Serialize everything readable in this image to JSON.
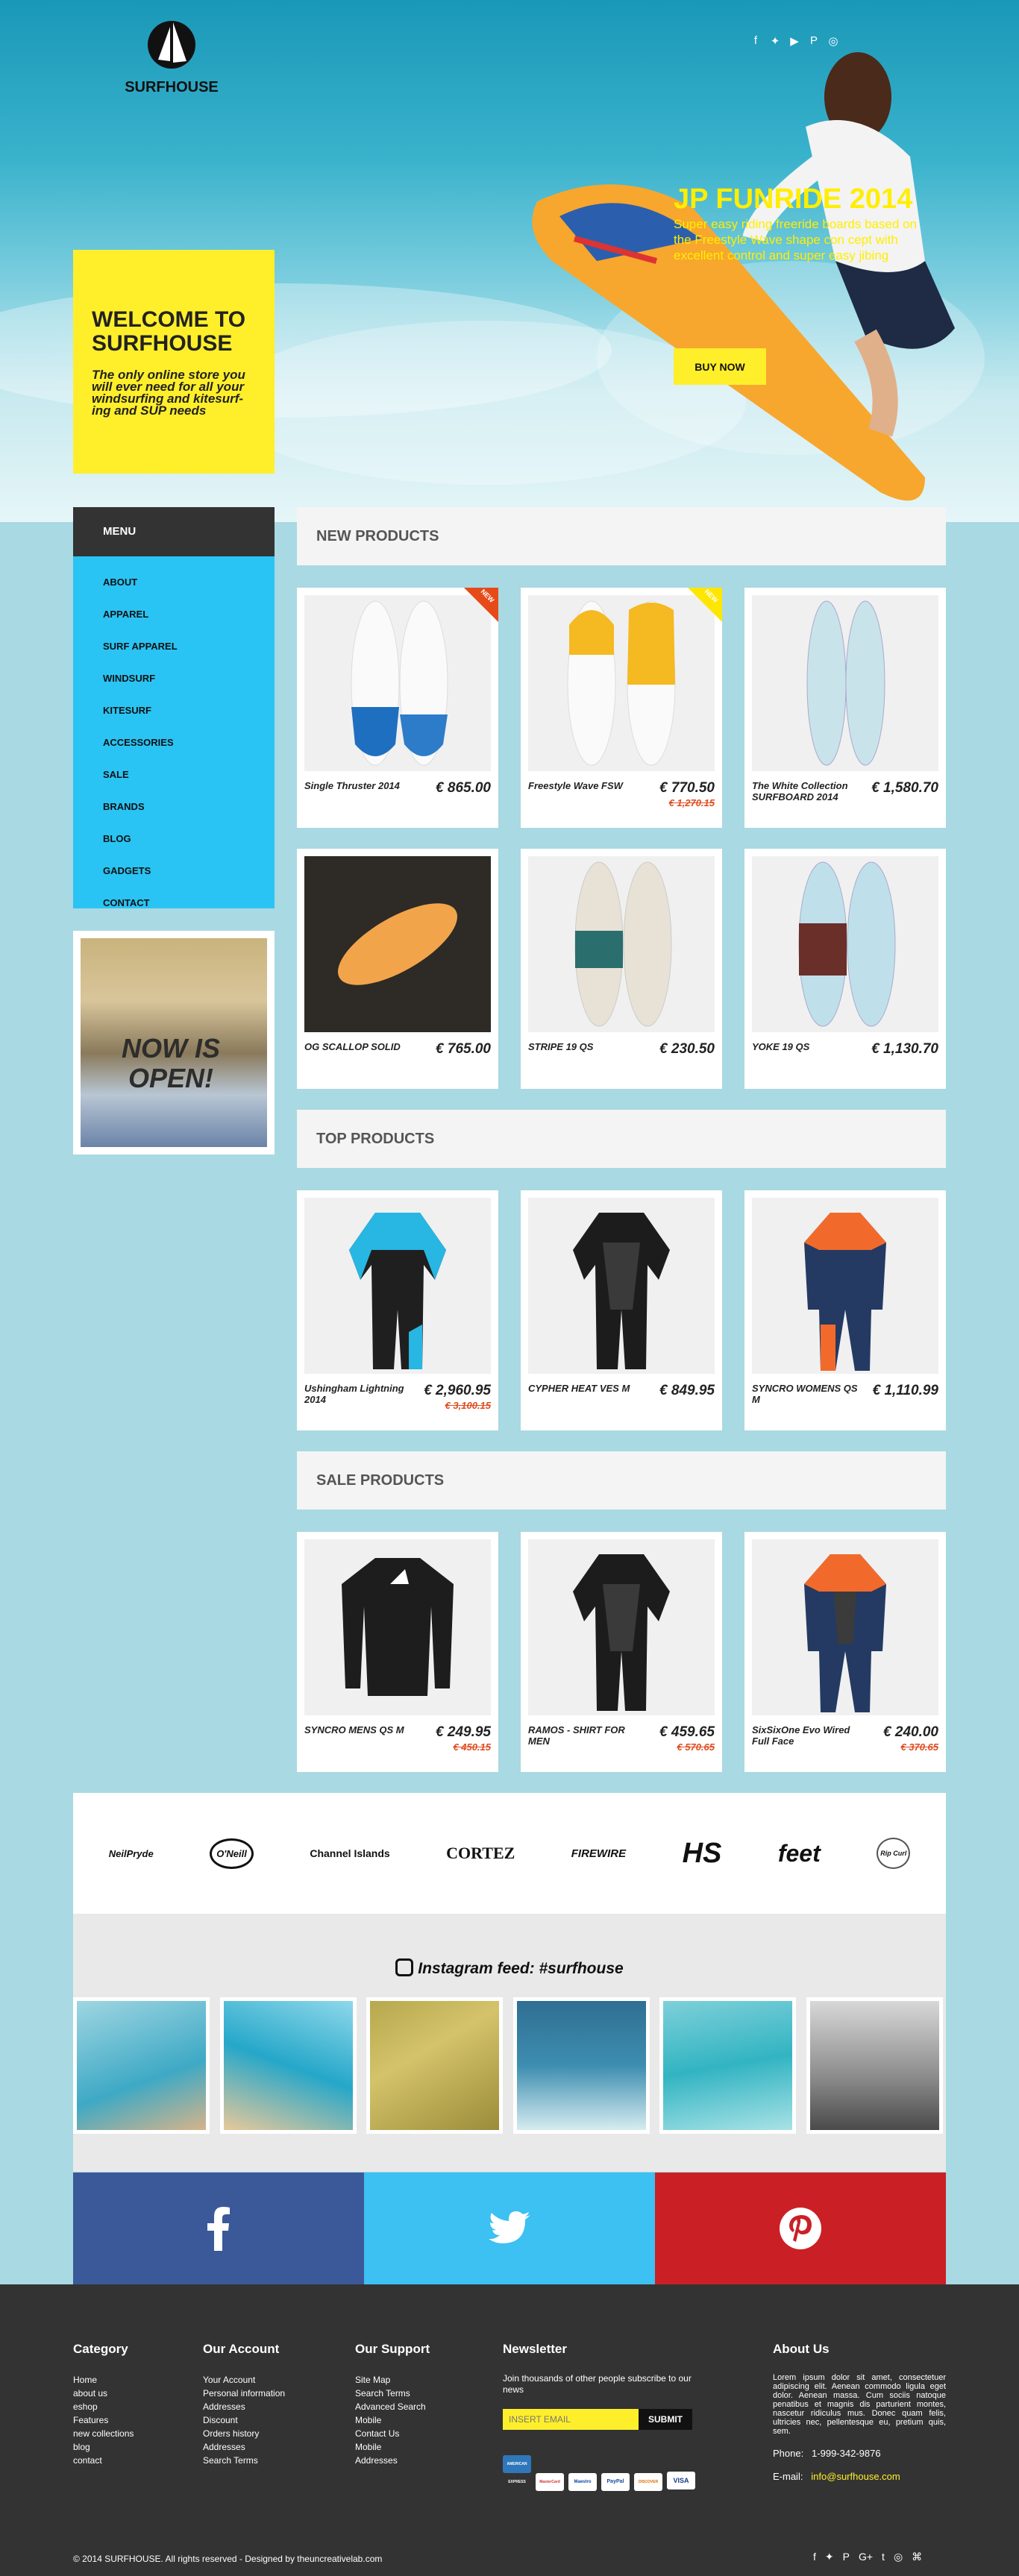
{
  "header": {
    "logo_text": "SURFHOUSE",
    "social_icons": [
      "facebook-icon",
      "twitter-icon",
      "youtube-icon",
      "pinterest-icon",
      "instagram-icon"
    ]
  },
  "welcome": {
    "title": "WELCOME TO SURFHOUSE",
    "subtitle": "The only online store you will ever need for all your windsurfing and kitesurf-ing and SUP needs"
  },
  "promo": {
    "title": "JP FUNRIDE 2014",
    "text": "Super easy riding freeride boards based on the Freestyle Wave shape con cept with excellent control and super easy jibing",
    "button": "BUY NOW"
  },
  "menu": {
    "title": "MENU",
    "items": [
      "ABOUT",
      "APPAREL",
      "SURF APPAREL",
      "WINDSURF",
      "KITESURF",
      "ACCESSORIES",
      "SALE",
      "BRANDS",
      "BLOG",
      "GADGETS",
      "CONTACT"
    ]
  },
  "shop_banner": "NOW IS OPEN!",
  "sections": {
    "new": "NEW PRODUCTS",
    "top": "TOP PRODUCTS",
    "sale": "SALE PRODUCTS"
  },
  "new_products": [
    {
      "name": "Single Thruster 2014",
      "price": "€ 865.00",
      "old": "",
      "tag": "NEW"
    },
    {
      "name": "Freestyle Wave FSW",
      "price": "€ 770.50",
      "old": "€ 1,270.15",
      "tag": "NEW"
    },
    {
      "name": "The White Collection SURFBOARD 2014",
      "price": "€ 1,580.70",
      "old": "",
      "tag": ""
    },
    {
      "name": "OG SCALLOP SOLID",
      "price": "€ 765.00",
      "old": "",
      "tag": ""
    },
    {
      "name": "STRIPE 19 QS",
      "price": "€ 230.50",
      "old": "",
      "tag": ""
    },
    {
      "name": "YOKE 19 QS",
      "price": "€ 1,130.70",
      "old": "",
      "tag": ""
    }
  ],
  "top_products": [
    {
      "name": "Ushingham Lightning 2014",
      "price": "€ 2,960.95",
      "old": "€ 3,100.15"
    },
    {
      "name": "CYPHER HEAT VES M",
      "price": "€ 849.95",
      "old": ""
    },
    {
      "name": "SYNCRO WOMENS QS M",
      "price": "€ 1,110.99",
      "old": ""
    }
  ],
  "sale_products": [
    {
      "name": "SYNCRO MENS QS M",
      "price": "€ 249.95",
      "old": "€ 450.15"
    },
    {
      "name": "RAMOS - SHIRT FOR MEN",
      "price": "€ 459.65",
      "old": "€ 570.65"
    },
    {
      "name": "SixSixOne Evo Wired Full Face",
      "price": "€ 240.00",
      "old": "€ 370.65"
    }
  ],
  "brands": [
    "NeilPryde",
    "O'Neill",
    "Channel Islands",
    "CORTEZ",
    "FIREWIRE",
    "HS",
    "feet",
    "Rip Curl"
  ],
  "instagram": {
    "title": "Instagram feed: #surfhouse"
  },
  "footer": {
    "category": {
      "title": "Category",
      "items": [
        "Home",
        "about us",
        "eshop",
        "Features",
        "new collections",
        "blog",
        "contact"
      ]
    },
    "account": {
      "title": "Our Account",
      "items": [
        "Your Account",
        "Personal information",
        "Addresses",
        "Discount",
        "Orders history",
        "Addresses",
        "Search Terms"
      ]
    },
    "support": {
      "title": "Our Support",
      "items": [
        "Site Map",
        "Search Terms",
        "Advanced Search",
        "Mobile",
        "Contact Us",
        "Mobile",
        "Addresses"
      ]
    },
    "newsletter": {
      "title": "Newsletter",
      "text": "Join thousands of other people subscribe to our news",
      "placeholder": "INSERT EMAIL",
      "button": "SUBMIT",
      "payments": [
        "AMERICAN EXPRESS",
        "MasterCard",
        "Maestro",
        "PayPal",
        "DISCOVER",
        "VISA"
      ]
    },
    "about": {
      "title": "About Us",
      "text": "Lorem ipsum dolor sit amet, consectetuer adipiscing elit. Aenean commodo ligula eget dolor. Aenean massa. Cum sociis natoque penatibus et magnis dis parturient montes, nascetur ridiculus mus. Donec quam felis, ultricies nec, pellentesque eu, pretium quis, sem.",
      "phone_label": "Phone:",
      "phone": "1-999-342-9876",
      "email_label": "E-mail:",
      "email": "info@surfhouse.com"
    },
    "copyright": "© 2014 SURFHOUSE. All rights reserved - Designed by theuncreativelab.com"
  }
}
